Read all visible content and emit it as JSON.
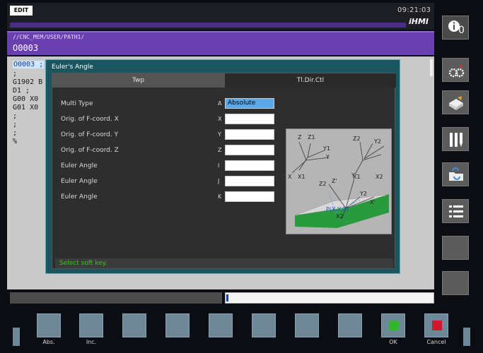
{
  "header": {
    "mode": "EDIT",
    "clock": "09:21:03",
    "brand": "iHMI"
  },
  "program": {
    "path": "//CNC_MEM/USER/PATH1/",
    "name": "O0003"
  },
  "editor": {
    "lines": [
      {
        "text": "O0003 ;",
        "highlight": true
      },
      {
        "text": ";",
        "highlight": false
      },
      {
        "text": "G1902 B",
        "highlight": false
      },
      {
        "text": "D1 ;",
        "highlight": false
      },
      {
        "text": "G00 X0",
        "highlight": false
      },
      {
        "text": "G01 X0",
        "highlight": false
      },
      {
        "text": ";",
        "highlight": false
      },
      {
        "text": ";",
        "highlight": false
      },
      {
        "text": ";",
        "highlight": false
      },
      {
        "text": "%",
        "highlight": false
      }
    ]
  },
  "dialog": {
    "title": "Euler's Angle",
    "tabs": [
      {
        "label": "Twp",
        "active": true
      },
      {
        "label": "Tl.Dir.Ctl",
        "active": false
      }
    ],
    "rows": [
      {
        "label": "Multi Type",
        "letter": "A",
        "value": "Absolute"
      },
      {
        "label": "Orig. of F-coord. X",
        "letter": "X",
        "value": ""
      },
      {
        "label": "Orig. of F-coord. Y",
        "letter": "Y",
        "value": ""
      },
      {
        "label": "Orig. of F-coord. Z",
        "letter": "Z",
        "value": ""
      },
      {
        "label": "Euler Angle",
        "letter": "I",
        "value": ""
      },
      {
        "label": "Euler Angle",
        "letter": "J",
        "value": ""
      },
      {
        "label": "Euler Angle",
        "letter": "K",
        "value": ""
      }
    ],
    "diagram_labels": {
      "z": "Z",
      "z1": "Z1",
      "y1": "Y1",
      "y": "Y",
      "x": "X",
      "x1": "X1",
      "z2": "Z2",
      "y2": "Y2",
      "x2": "X2",
      "zp": "Z'",
      "yp": "Y'",
      "xp": "X'",
      "p": "P(X,Y,Z)"
    },
    "message": "Select soft key."
  },
  "side_icons": [
    "info-icon",
    "settings-gears-icon",
    "workpiece-icon",
    "tools-icon",
    "folder-icon",
    "list-icon",
    "blank-button-icon",
    "blank-button-icon"
  ],
  "side_badge": "0",
  "softkeys": [
    {
      "label": "Abs."
    },
    {
      "label": "Inc."
    },
    {
      "label": ""
    },
    {
      "label": ""
    },
    {
      "label": ""
    },
    {
      "label": ""
    },
    {
      "label": ""
    },
    {
      "label": ""
    },
    {
      "label": "OK"
    },
    {
      "label": "Cancel"
    }
  ],
  "colors": {
    "accent_purple": "#6a3fb0",
    "dialog_teal": "#1b5560",
    "selected_field": "#5aa8e8",
    "ok_green": "#2fb82f",
    "cancel_red": "#d1162d",
    "message_green": "#3fc21f"
  }
}
